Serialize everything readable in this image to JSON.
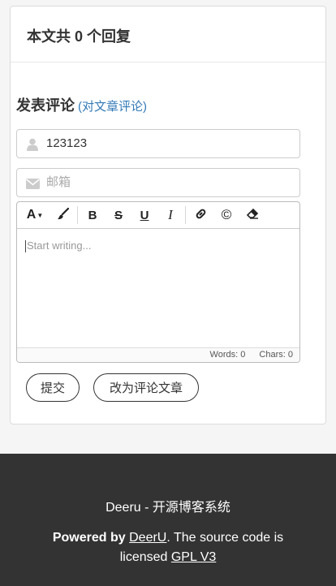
{
  "comments": {
    "header_prefix": "本文共",
    "count": "0",
    "header_suffix": "个回复"
  },
  "form": {
    "title": "发表评论",
    "subtitle": "(对文章评论)",
    "name_value": "123123",
    "email_placeholder": "邮箱",
    "editor_placeholder": "Start writing...",
    "words_label": "Words: 0",
    "chars_label": "Chars: 0",
    "submit_label": "提交",
    "switch_label": "改为评论文章"
  },
  "toolbar": {
    "font_size_label": "A",
    "bold_label": "B",
    "strike_label": "S",
    "underline_label": "U",
    "italic_label": "I",
    "copyright_label": "©"
  },
  "footer": {
    "site": "Deeru - 开源博客系统",
    "powered_by": "Powered by",
    "powered_link": "DeerU",
    "source_text": ". The source code is licensed",
    "license_link": "GPL V3"
  }
}
